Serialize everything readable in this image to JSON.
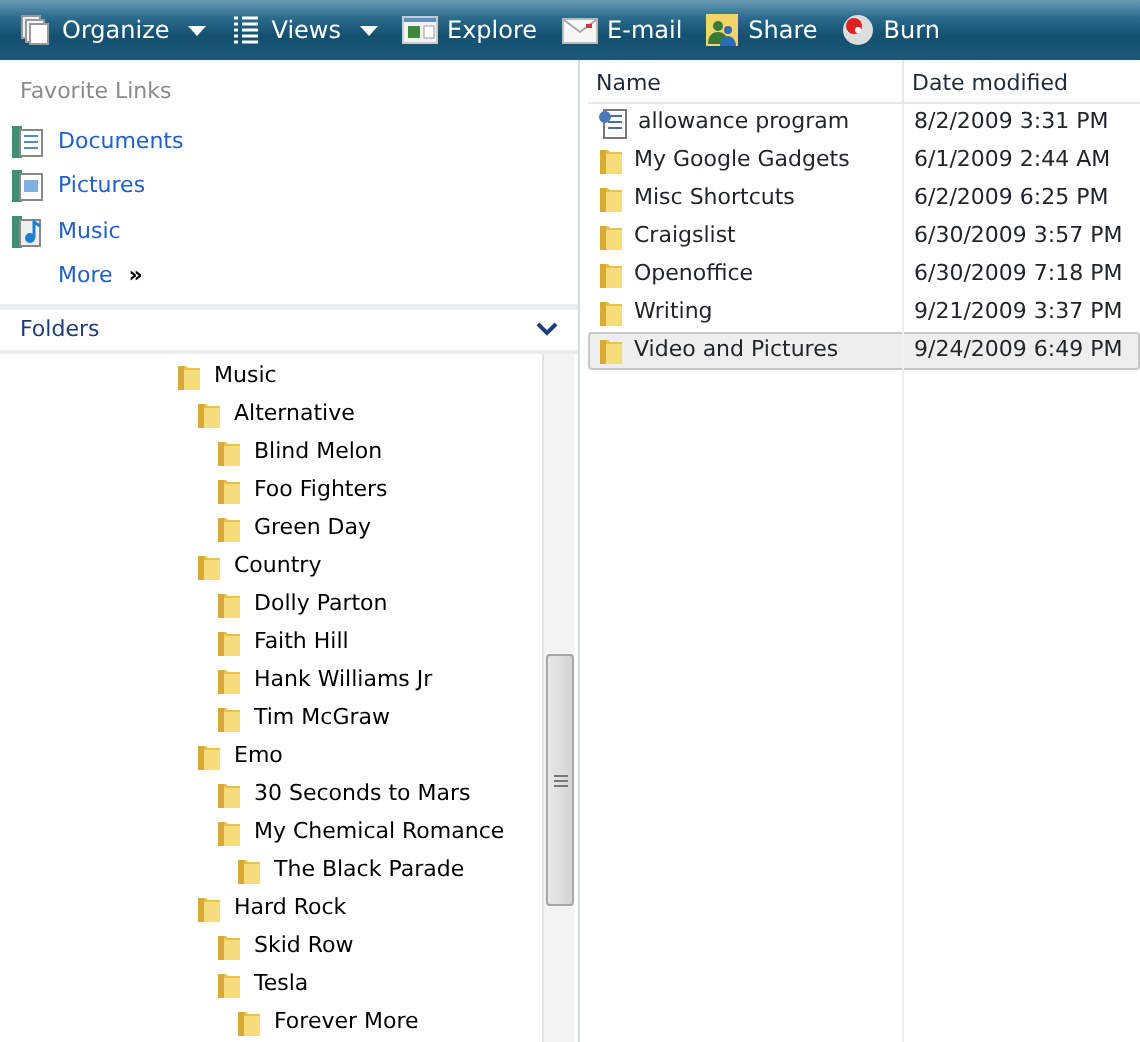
{
  "toolbar": [
    {
      "label": "Organize",
      "dropdown": true
    },
    {
      "label": "Views",
      "dropdown": true
    },
    {
      "label": "Explore",
      "dropdown": false
    },
    {
      "label": "E-mail",
      "dropdown": false
    },
    {
      "label": "Share",
      "dropdown": false
    },
    {
      "label": "Burn",
      "dropdown": false
    }
  ],
  "favorite_links": {
    "title": "Favorite Links",
    "items": [
      {
        "label": "Documents"
      },
      {
        "label": "Pictures"
      },
      {
        "label": "Music"
      }
    ],
    "more": "More",
    "more_glyph": "»"
  },
  "folders": {
    "title": "Folders",
    "expanded": true,
    "tree": [
      {
        "label": "Music",
        "children": [
          {
            "label": "Alternative",
            "children": [
              {
                "label": "Blind Melon"
              },
              {
                "label": "Foo Fighters"
              },
              {
                "label": "Green Day"
              }
            ]
          },
          {
            "label": "Country",
            "children": [
              {
                "label": "Dolly Parton"
              },
              {
                "label": "Faith Hill"
              },
              {
                "label": "Hank Williams Jr"
              },
              {
                "label": "Tim McGraw"
              }
            ]
          },
          {
            "label": "Emo",
            "children": [
              {
                "label": "30 Seconds to Mars"
              },
              {
                "label": "My Chemical Romance",
                "children": [
                  {
                    "label": "The Black Parade"
                  }
                ]
              }
            ]
          },
          {
            "label": "Hard Rock",
            "children": [
              {
                "label": "Skid Row"
              },
              {
                "label": "Tesla",
                "children": [
                  {
                    "label": "Forever More"
                  }
                ]
              }
            ]
          }
        ]
      }
    ]
  },
  "file_list": {
    "columns": [
      "Name",
      "Date modified"
    ],
    "rows": [
      {
        "name": "allowance program",
        "date": "8/2/2009 3:31 PM",
        "kind": "file",
        "selected": false
      },
      {
        "name": "My Google Gadgets",
        "date": "6/1/2009 2:44 AM",
        "kind": "folder",
        "selected": false
      },
      {
        "name": "Misc Shortcuts",
        "date": "6/2/2009 6:25 PM",
        "kind": "folder",
        "selected": false
      },
      {
        "name": "Craigslist",
        "date": "6/30/2009 3:57 PM",
        "kind": "folder",
        "selected": false
      },
      {
        "name": "Openoffice",
        "date": "6/30/2009 7:18 PM",
        "kind": "folder",
        "selected": false
      },
      {
        "name": "Writing",
        "date": "9/21/2009 3:37 PM",
        "kind": "folder",
        "selected": false
      },
      {
        "name": "Video and Pictures",
        "date": "9/24/2009 6:49 PM",
        "kind": "folder",
        "selected": true
      }
    ]
  }
}
